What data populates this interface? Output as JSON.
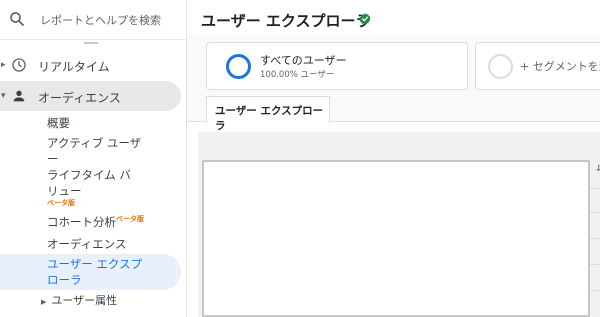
{
  "sidebar": {
    "search_placeholder": "レポートとヘルプを検索",
    "items": [
      {
        "label": "リアルタイム",
        "icon": "clock-icon"
      },
      {
        "label": "オーディエンス",
        "icon": "person-icon"
      }
    ],
    "audience_sub": {
      "overview": "概要",
      "active_users": "アクティブ ユーザー",
      "lifetime_value": "ライフタイム バリュー",
      "lifetime_beta": "ベータ版",
      "cohort": "コホート分析",
      "cohort_beta": "ベータ版",
      "audiences": "オーディエンス",
      "user_explorer": "ユーザー エクスプローラ",
      "user_attributes": "ユーザー属性"
    }
  },
  "main": {
    "title": "ユーザー エクスプローラ",
    "segments": {
      "all_users_name": "すべてのユーザー",
      "all_users_pct": "100.00% ユーザー",
      "add_segment": "+ セグメントを追"
    },
    "tab_label": "ユーザー エクスプローラ"
  },
  "colors": {
    "accent": "#1a73e8",
    "active_bg": "#e8f0fe",
    "beta": "#e37400",
    "verified": "#1e8e3e"
  }
}
